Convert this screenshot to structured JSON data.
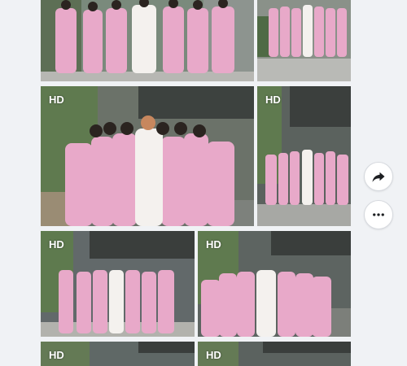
{
  "gallery": {
    "badge": "HD",
    "tiles": [
      {
        "name": "photo-1",
        "hd": false
      },
      {
        "name": "photo-2",
        "hd": false
      },
      {
        "name": "photo-3",
        "hd": true
      },
      {
        "name": "photo-4",
        "hd": true
      },
      {
        "name": "photo-5",
        "hd": true
      },
      {
        "name": "photo-6",
        "hd": true
      },
      {
        "name": "photo-7",
        "hd": true
      },
      {
        "name": "photo-8",
        "hd": true
      }
    ]
  },
  "actions": {
    "share_icon": "share-arrow-icon",
    "more_icon": "more-dots-icon"
  },
  "colors": {
    "background": "#f0f2f5",
    "dress_pink": "#e8a9c9",
    "dress_white": "#f4f1ee"
  }
}
